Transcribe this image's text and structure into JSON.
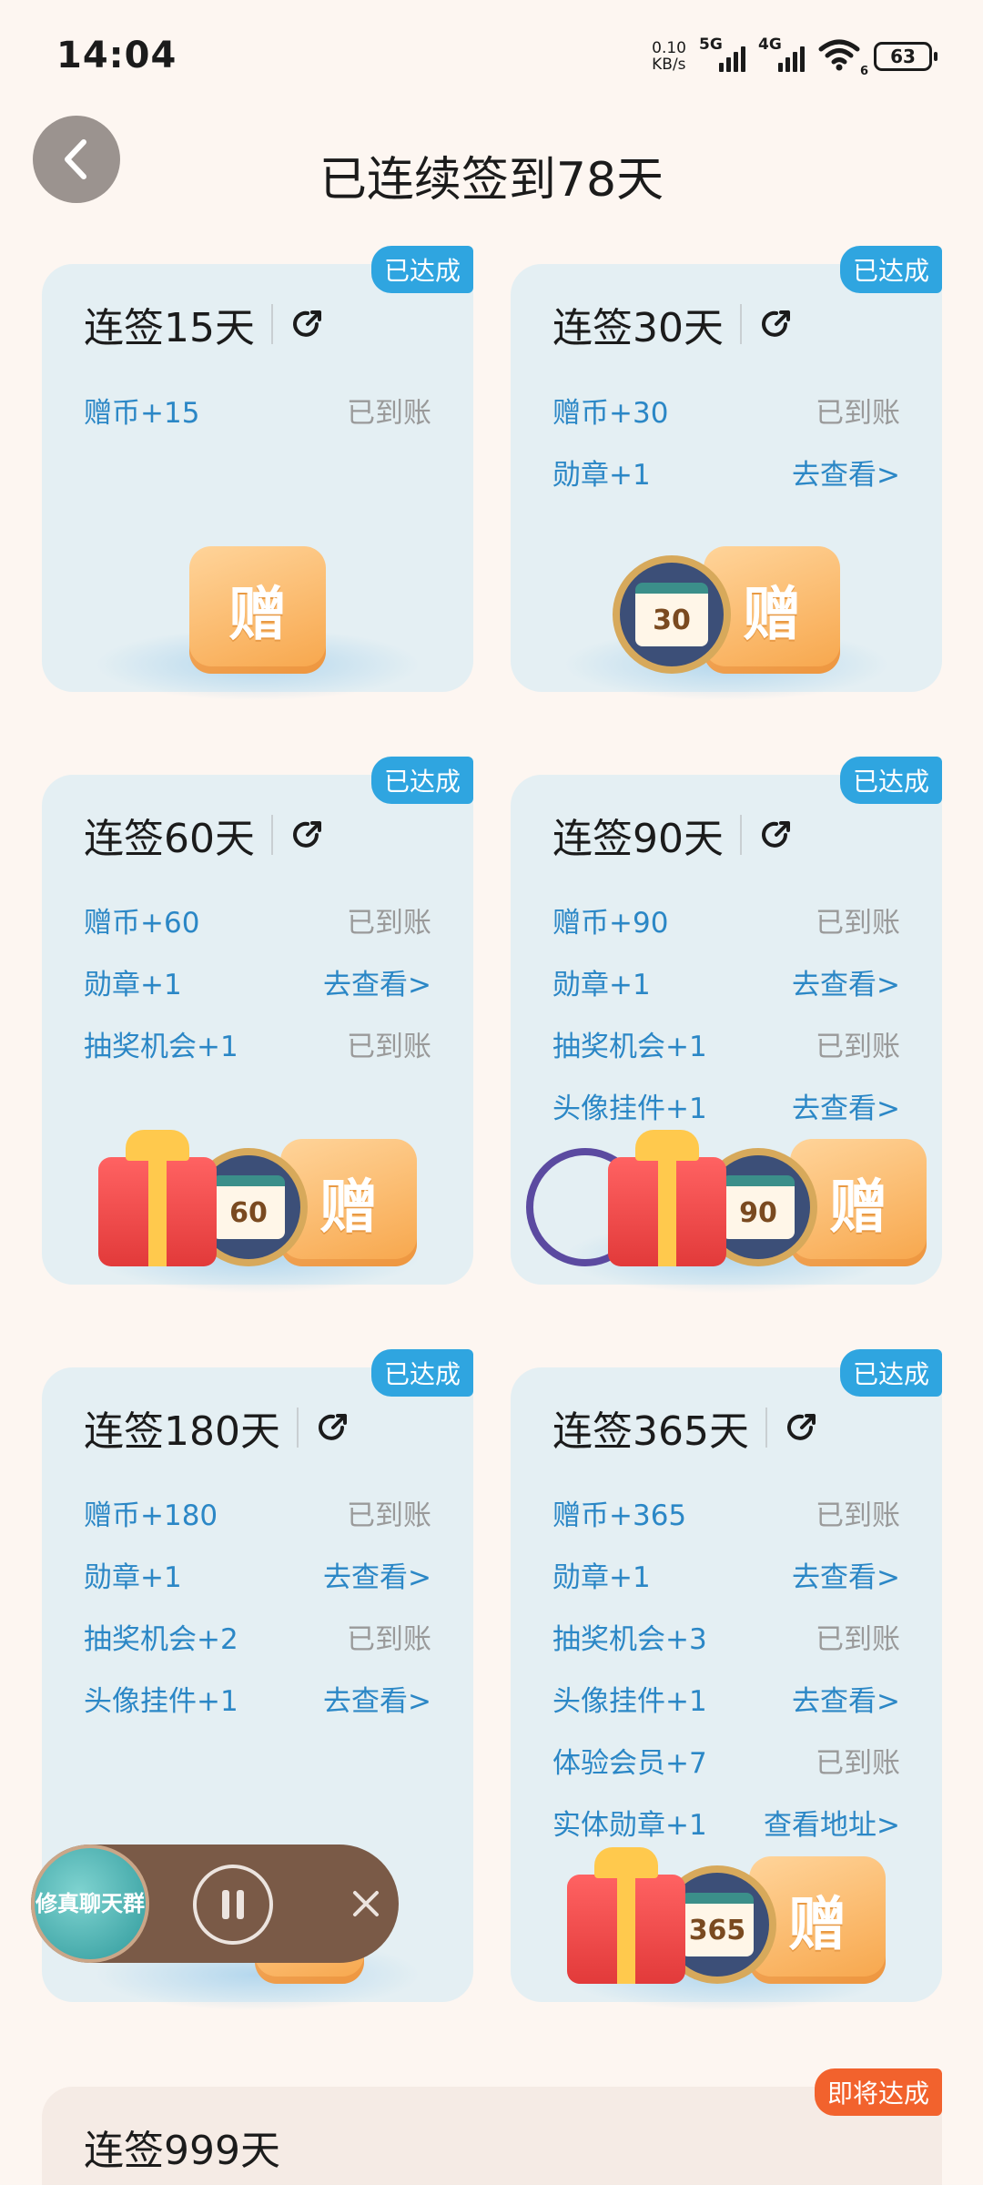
{
  "status_bar": {
    "time": "14:04",
    "net_speed_value": "0.10",
    "net_speed_unit": "KB/s",
    "sim1_type": "5G",
    "sim2_type": "4G",
    "wifi_sub": "6",
    "battery": "63"
  },
  "header": {
    "title": "已连续签到78天"
  },
  "cards": [
    {
      "title": "连签15天",
      "tag": "已达成",
      "rows": [
        {
          "label": "赠币+15",
          "status": "已到账"
        }
      ],
      "art_ticket": "赠"
    },
    {
      "title": "连签30天",
      "tag": "已达成",
      "rows": [
        {
          "label": "赠币+30",
          "status": "已到账"
        },
        {
          "label": "勋章+1",
          "status": "去查看>"
        }
      ],
      "art_medal": "30",
      "art_ticket": "赠"
    },
    {
      "title": "连签60天",
      "tag": "已达成",
      "rows": [
        {
          "label": "赠币+60",
          "status": "已到账"
        },
        {
          "label": "勋章+1",
          "status": "去查看>"
        },
        {
          "label": "抽奖机会+1",
          "status": "已到账"
        }
      ],
      "art_medal": "60",
      "art_ticket": "赠"
    },
    {
      "title": "连签90天",
      "tag": "已达成",
      "rows": [
        {
          "label": "赠币+90",
          "status": "已到账"
        },
        {
          "label": "勋章+1",
          "status": "去查看>"
        },
        {
          "label": "抽奖机会+1",
          "status": "已到账"
        },
        {
          "label": "头像挂件+1",
          "status": "去查看>"
        }
      ],
      "art_medal": "90",
      "art_ticket": "赠"
    },
    {
      "title": "连签180天",
      "tag": "已达成",
      "rows": [
        {
          "label": "赠币+180",
          "status": "已到账"
        },
        {
          "label": "勋章+1",
          "status": "去查看>"
        },
        {
          "label": "抽奖机会+2",
          "status": "已到账"
        },
        {
          "label": "头像挂件+1",
          "status": "去查看>"
        }
      ]
    },
    {
      "title": "连签365天",
      "tag": "已达成",
      "rows": [
        {
          "label": "赠币+365",
          "status": "已到账"
        },
        {
          "label": "勋章+1",
          "status": "去查看>"
        },
        {
          "label": "抽奖机会+3",
          "status": "已到账"
        },
        {
          "label": "头像挂件+1",
          "status": "去查看>"
        },
        {
          "label": "体验会员+7",
          "status": "已到账"
        },
        {
          "label": "实体勋章+1",
          "status": "查看地址>"
        }
      ],
      "art_medal": "365",
      "art_ticket": "赠"
    },
    {
      "title": "连签999天",
      "tag": "即将达成"
    }
  ],
  "floating_player": {
    "avatar_text": "修真聊天群"
  }
}
